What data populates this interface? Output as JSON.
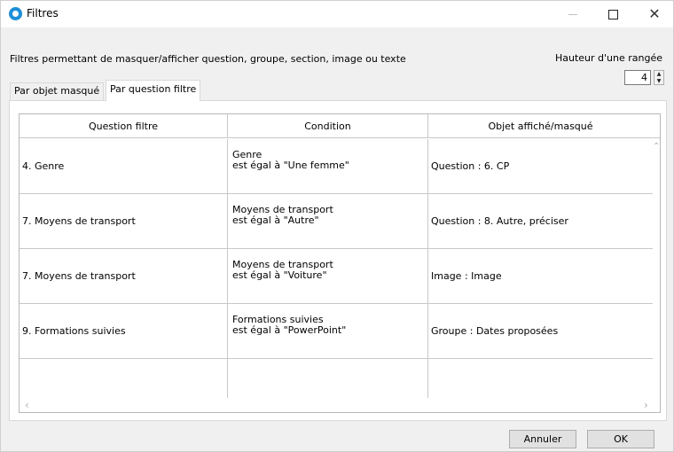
{
  "window": {
    "title": "Filtres",
    "min_glyph": "—",
    "max_glyph": "☐",
    "close_glyph": "✕"
  },
  "header": {
    "description": "Filtres permettant de masquer/afficher question, groupe, section, image ou texte",
    "row_height_label": "Hauteur d'une rangée",
    "row_height_value": "4"
  },
  "tabs": [
    {
      "label": "Par objet masqué"
    },
    {
      "label": "Par question filtre"
    }
  ],
  "grid": {
    "columns": [
      "Question filtre",
      "Condition",
      "Objet affiché/masqué"
    ],
    "rows": [
      {
        "question": "4. Genre",
        "condition_line1": "Genre",
        "condition_line2": "est égal à \"Une femme\"",
        "object": "Question : 6. CP"
      },
      {
        "question": "7. Moyens de transport",
        "condition_line1": "Moyens de transport",
        "condition_line2": "est égal à \"Autre\"",
        "object": "Question : 8. Autre, préciser"
      },
      {
        "question": "7. Moyens de transport",
        "condition_line1": "Moyens de transport",
        "condition_line2": "est égal à \"Voiture\"",
        "object": "Image : Image"
      },
      {
        "question": "9. Formations suivies",
        "condition_line1": "Formations suivies",
        "condition_line2": "est égal à \"PowerPoint\"",
        "object": "Groupe : Dates proposées"
      },
      {
        "question": "",
        "condition_line1": "",
        "condition_line2": "",
        "object": ""
      }
    ]
  },
  "buttons": {
    "cancel": "Annuler",
    "ok": "OK"
  },
  "colors": {
    "app_icon": "#1d8fd8",
    "window_bg": "#f0f0f0",
    "grid_lines": "#c8c8c8"
  }
}
